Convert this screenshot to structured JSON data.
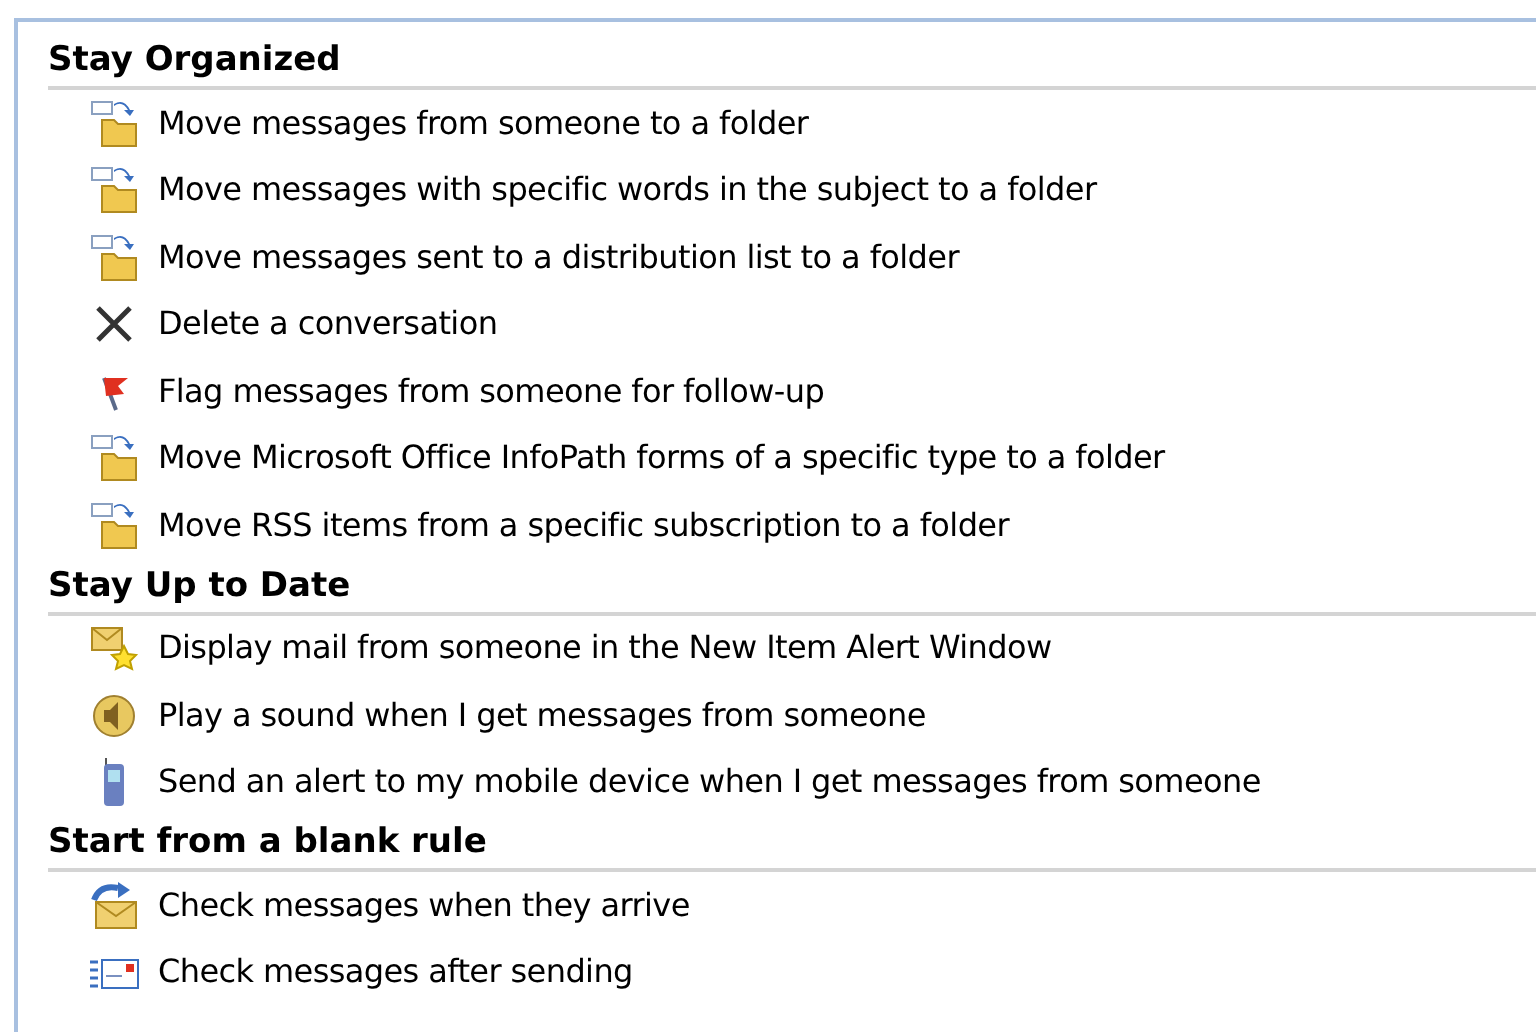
{
  "sections": [
    {
      "title": "Stay Organized",
      "items": [
        {
          "kind": "move",
          "label": "Move messages from someone to a folder"
        },
        {
          "kind": "move",
          "label": "Move messages with specific words in the subject to a folder"
        },
        {
          "kind": "move",
          "label": "Move messages sent to a distribution list to a folder"
        },
        {
          "kind": "delete",
          "label": "Delete a conversation"
        },
        {
          "kind": "flag",
          "label": "Flag messages from someone for follow-up"
        },
        {
          "kind": "move",
          "label": "Move Microsoft Office InfoPath forms of a specific type to a folder"
        },
        {
          "kind": "move",
          "label": "Move RSS items from a specific subscription to a folder"
        }
      ]
    },
    {
      "title": "Stay Up to Date",
      "items": [
        {
          "kind": "alert",
          "label": "Display mail from someone in the New Item Alert Window"
        },
        {
          "kind": "sound",
          "label": "Play a sound when I get messages from someone"
        },
        {
          "kind": "mobile",
          "label": "Send an alert to my mobile device when I get messages from someone"
        }
      ]
    },
    {
      "title": "Start from a blank rule",
      "items": [
        {
          "kind": "arrive",
          "label": "Check messages when they arrive"
        },
        {
          "kind": "sent",
          "label": "Check messages after sending"
        }
      ]
    }
  ]
}
